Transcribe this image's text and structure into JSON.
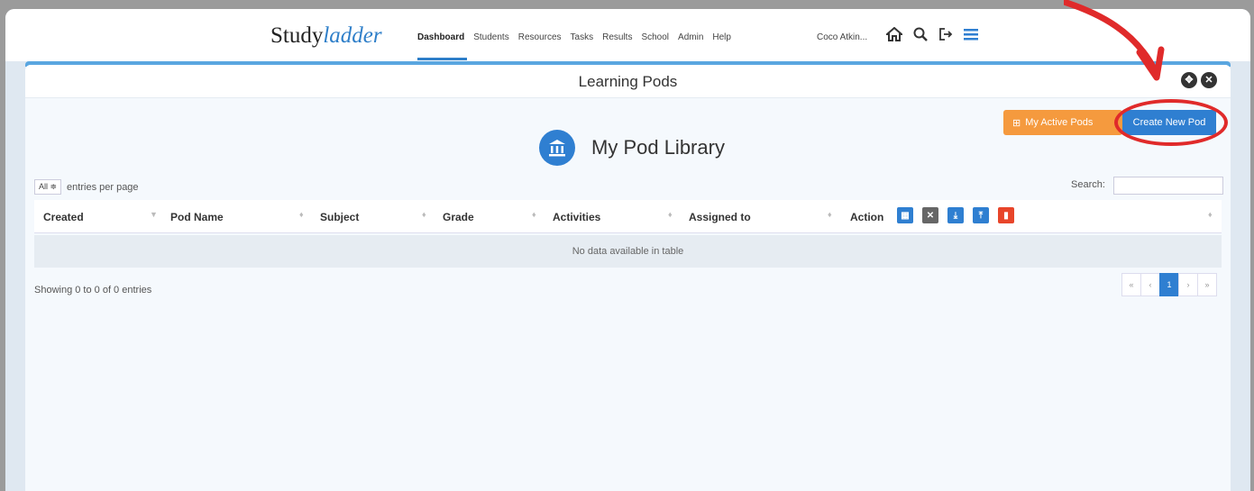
{
  "brand": {
    "prefix": "Study",
    "suffix": "ladder"
  },
  "nav": {
    "links": [
      "Dashboard",
      "Students",
      "Resources",
      "Tasks",
      "Results",
      "School",
      "Admin",
      "Help"
    ],
    "active": "Dashboard",
    "user": "Coco Atkin..."
  },
  "icons": {
    "home": "home-icon",
    "search": "search-icon",
    "logout": "logout-icon",
    "menu": "menu-icon"
  },
  "panel": {
    "title": "Learning Pods",
    "active_pods_label": "My Active Pods",
    "create_label": "Create New Pod",
    "library_title": "My Pod Library"
  },
  "table": {
    "entries_select": "All ≑",
    "entries_label": "entries per page",
    "search_label": "Search:",
    "columns": [
      "Created",
      "Pod Name",
      "Subject",
      "Grade",
      "Activities",
      "Assigned to",
      "Action"
    ],
    "empty_message": "No data available in table",
    "showing": "Showing 0 to 0 of 0 entries"
  },
  "pagination": [
    "«",
    "‹",
    "1",
    "›",
    "»"
  ],
  "colors": {
    "accent": "#2f7fd1",
    "orange": "#f59a3e",
    "danger": "#e8452a",
    "annotation": "#e02a2a"
  }
}
